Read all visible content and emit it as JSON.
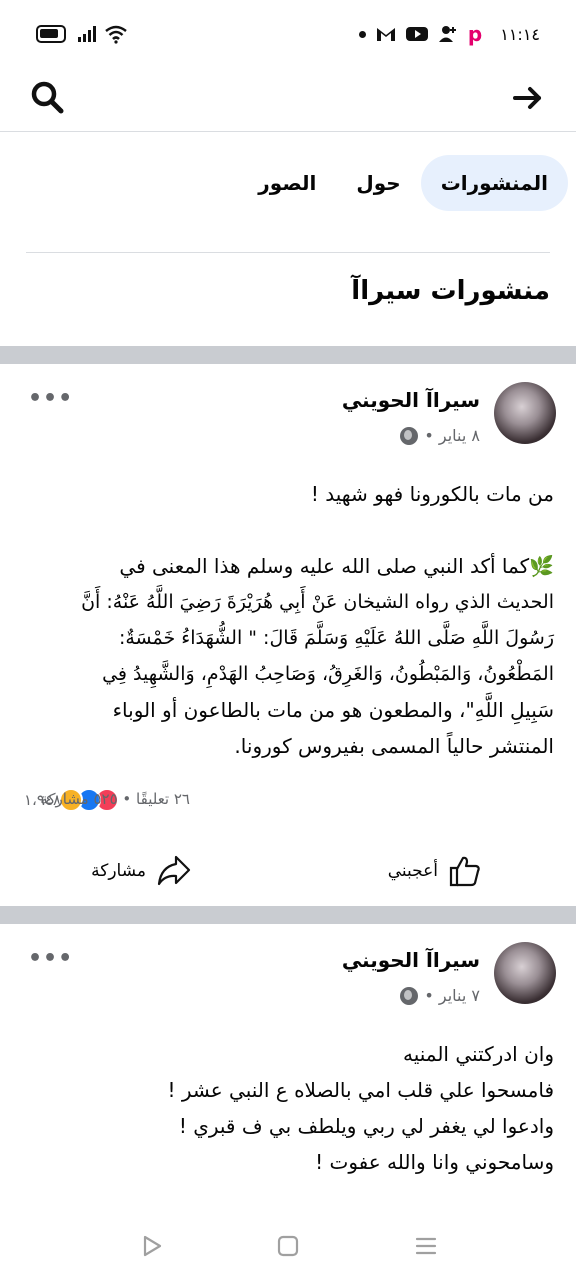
{
  "status_bar": {
    "time": "١١:١٤",
    "icons": [
      "battery-icon",
      "signal-icon",
      "wifi-icon",
      "dot-icon",
      "gmail-icon",
      "youtube-icon",
      "person-add-icon",
      "picsart-icon"
    ]
  },
  "top_bar": {
    "search_icon": "search-icon",
    "back_icon": "arrow-right-icon"
  },
  "tabs": [
    {
      "label": "المنشورات",
      "active": true
    },
    {
      "label": "حول",
      "active": false
    },
    {
      "label": "الصور",
      "active": false
    }
  ],
  "section_title": "منشورات سيراآ",
  "posts": [
    {
      "author": "سيراآ الحويني",
      "date": "٨ يناير •",
      "more": "•••",
      "lines": [
        "من مات بالكورونا فهو شهيد !",
        "",
        "🌿كما أكد النبي صلى الله عليه وسلم هذا المعنى في",
        "الحديث الذي رواه الشيخان عَنْ أَبِي هُرَيْرَةَ رَضِيَ اللَّهُ عَنْهُ: أَنَّ",
        "رَسُولَ اللَّهِ صَلَّى اللهُ عَلَيْهِ وَسَلَّمَ قَالَ: \" الشُّهَدَاءُ خَمْسَةٌ:",
        "المَطْعُونُ، وَالمَبْطُونُ، وَالغَرِقُ، وَصَاحِبُ الهَدْمِ، وَالشَّهِيدُ فِي",
        "سَبِيلِ اللَّهِ\"، والمطعون هو من مات بالطاعون أو الوباء",
        "المنتشر حالياً المسمى بفيروس كورونا."
      ],
      "reaction_count": "١،٩٤٨",
      "stats": "٢٦ تعليقًا • ٥٢٥ مشاركة",
      "like_label": "أعجبني",
      "share_label": "مشاركة"
    },
    {
      "author": "سيراآ الحويني",
      "date": "٧ يناير •",
      "more": "•••",
      "lines": [
        "وان ادركتني المنيه",
        "فامسحوا علي قلب امي بالصلاه ع النبي عشر !",
        "وادعوا لي يغفر لي ربي ويلطف بي ف قبري !",
        "وسامحوني وانا والله عفوت !"
      ]
    }
  ],
  "nav_bar": {
    "icons": [
      "back-triangle-icon",
      "home-square-icon",
      "recents-menu-icon"
    ]
  }
}
